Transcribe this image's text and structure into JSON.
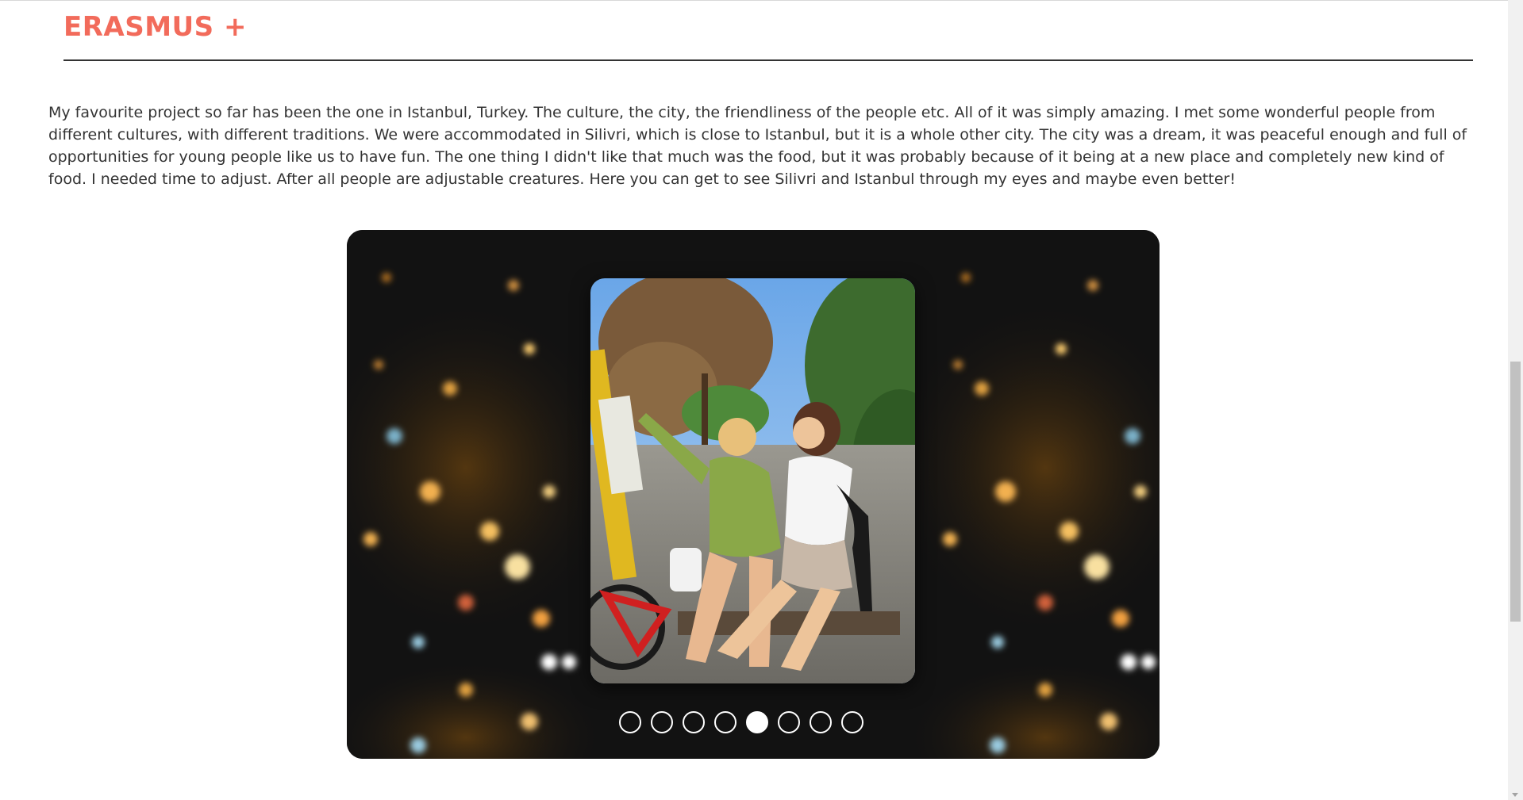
{
  "section": {
    "title": "ERASMUS +"
  },
  "intro": {
    "text": "My favourite project so far has been the one in Istanbul, Turkey. The culture, the city, the friendliness of the people etc. All of it was simply amazing. I met some wonderful people from different cultures, with different traditions. We were accommodated in Silivri, which is close to Istanbul, but it is a whole other city. The city was a dream, it was peaceful enough and full of opportunities for young people like us to have fun. The one thing I didn't like that much was the food, but it was probably because of it being at a new place and completely new kind of food. I needed time to adjust. After all people are adjustable creatures. Here you can get to see Silivri and Istanbul through my eyes and maybe even better!"
  },
  "slider": {
    "slide_count": 8,
    "active_slide": 5
  },
  "colors": {
    "accent": "#f26b5b",
    "text": "#333333",
    "rule": "#333333"
  }
}
